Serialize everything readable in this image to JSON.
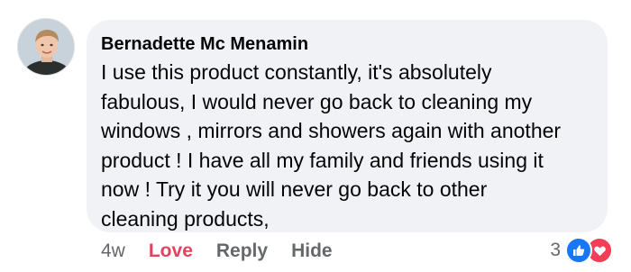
{
  "comment": {
    "author": "Bernadette Mc Menamin",
    "text": "I use this product constantly, it's absolutely\nfabulous, I would never go back to cleaning my\nwindows , mirrors and showers again with another\nproduct  ! I have all my family and friends using it\nnow ! Try it you will never go back to other\ncleaning products,",
    "time": "4w",
    "actions": {
      "love": "Love",
      "reply": "Reply",
      "hide": "Hide"
    },
    "reactions": {
      "count": "3",
      "icons": [
        "like-icon",
        "love-icon"
      ]
    }
  },
  "colors": {
    "bubble": "#f0f2f5",
    "love_action": "#e4425d",
    "like_reaction": "#1877f2",
    "love_reaction": "#f33e58",
    "muted": "#65676b"
  }
}
